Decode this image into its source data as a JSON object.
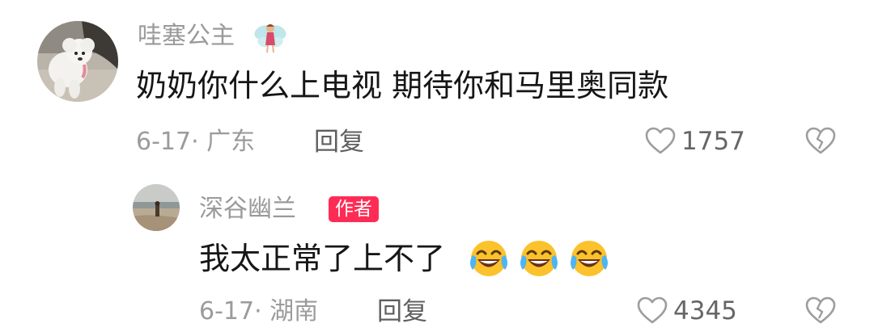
{
  "comments": [
    {
      "username": "哇塞公主",
      "text": "奶奶你什么上电视  期待你和马里奥同款",
      "date_location": "6-17· 广东",
      "reply_label": "回复",
      "like_count": "1757",
      "avatar_icon": "white-poodle-avatar",
      "username_icon": "fairy-emoji-icon"
    },
    {
      "username": "深谷幽兰",
      "badge": "作者",
      "text": "我太正常了上不了",
      "emojis": [
        "laughing-crying-emoji",
        "laughing-crying-emoji",
        "laughing-crying-emoji"
      ],
      "date_location": "6-17· 湖南",
      "reply_label": "回复",
      "like_count": "4345",
      "avatar_icon": "beach-landscape-avatar"
    }
  ],
  "colors": {
    "badge_bg": "#fe2c55",
    "username": "#9a9a9a",
    "text": "#161616",
    "meta": "#9b9b9b",
    "reply": "#5f5f5f",
    "icon": "#9d9d9d"
  }
}
